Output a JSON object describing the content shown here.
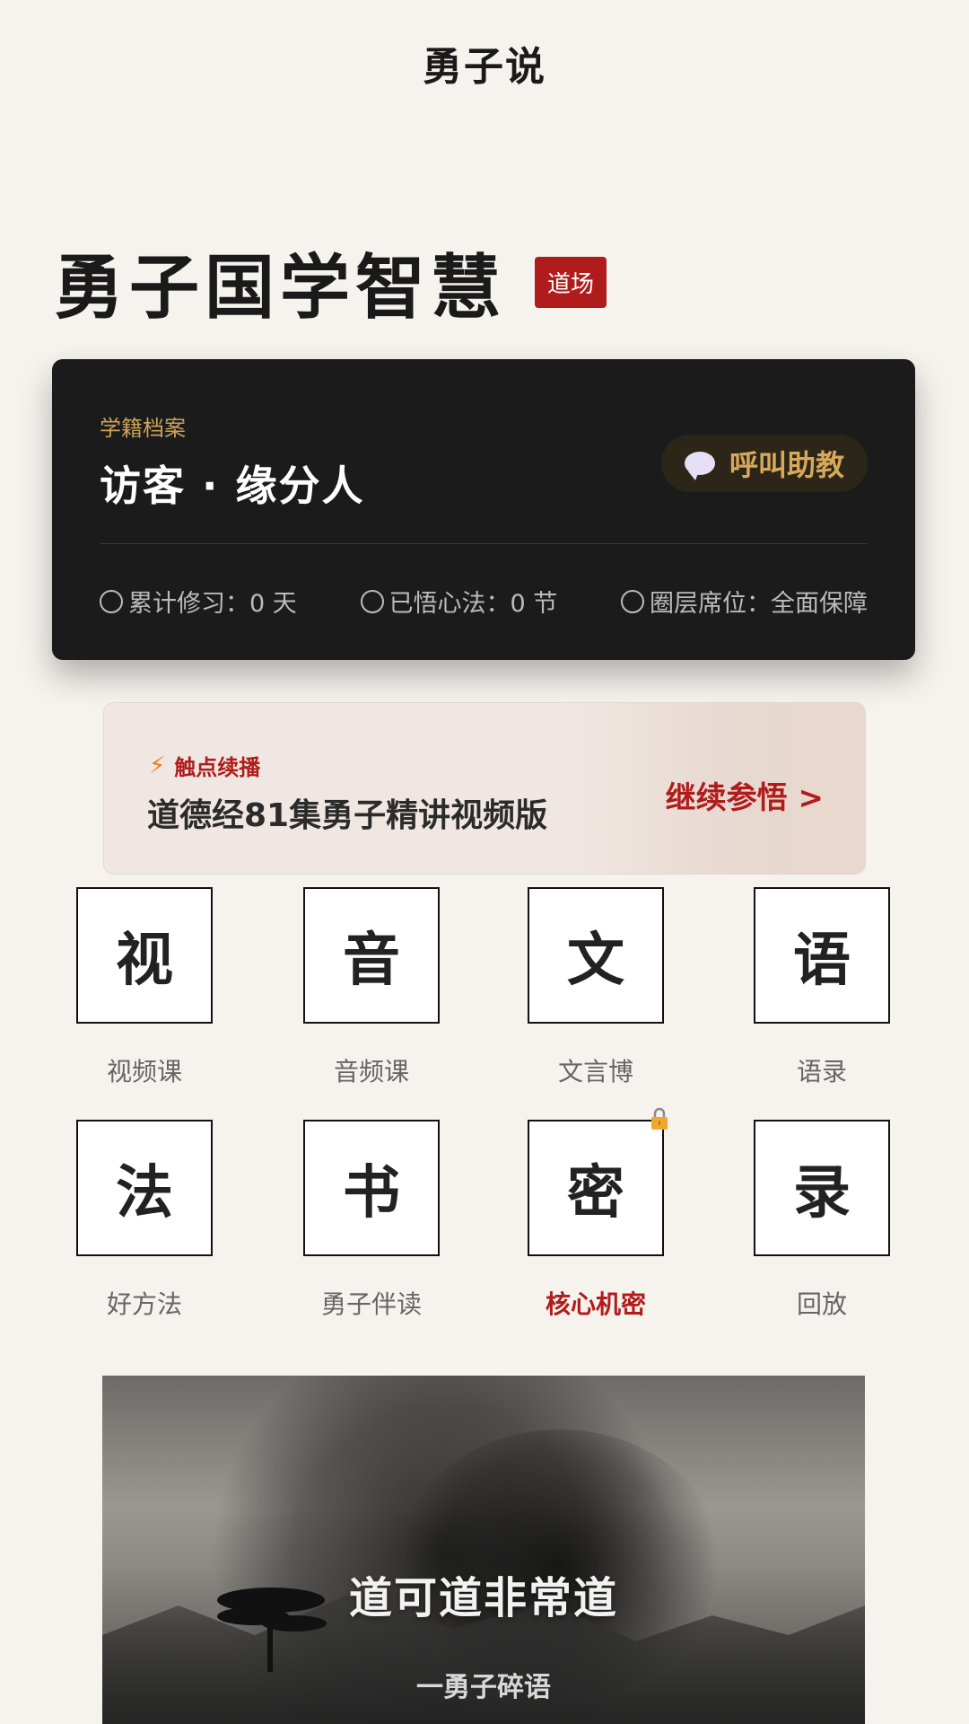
{
  "topbar": {
    "title": "勇子说"
  },
  "hero": {
    "title": "勇子国学智慧",
    "badge": "道场"
  },
  "profile": {
    "label": "学籍档案",
    "name": "访客 · 缘分人",
    "call_button": "呼叫助教",
    "stats": [
      {
        "label": "累计修习：0 天"
      },
      {
        "label": "已悟心法：0 节"
      },
      {
        "label": "圈层席位：全面保障"
      }
    ]
  },
  "resume": {
    "tag": "触点续播",
    "title": "道德经81集勇子精讲视频版",
    "cta": "继续参悟 >"
  },
  "grid": {
    "items": [
      {
        "glyph": "视",
        "caption": "视频课"
      },
      {
        "glyph": "音",
        "caption": "音频课"
      },
      {
        "glyph": "文",
        "caption": "文言博"
      },
      {
        "glyph": "语",
        "caption": "语录"
      },
      {
        "glyph": "法",
        "caption": "好方法"
      },
      {
        "glyph": "书",
        "caption": "勇子伴读"
      },
      {
        "glyph": "密",
        "caption": "核心机密",
        "locked": true,
        "highlight": "#b01c1c"
      },
      {
        "glyph": "录",
        "caption": "回放"
      }
    ]
  },
  "banner": {
    "quote": "道可道非常道",
    "source": "一勇子碎语"
  },
  "colors": {
    "accent": "#b01c1c",
    "gold": "#c9a35a",
    "background": "#f6f3ee"
  }
}
